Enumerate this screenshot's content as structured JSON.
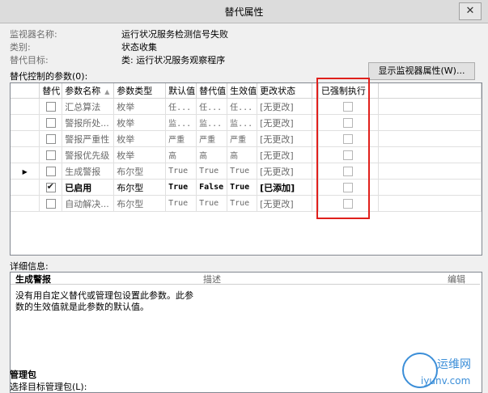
{
  "window": {
    "title": "替代属性",
    "close_symbol": "✕"
  },
  "info": [
    {
      "key": "监视器名称:",
      "value": "运行状况服务检测信号失败"
    },
    {
      "key": "类别:",
      "value": "状态收集"
    },
    {
      "key": "替代目标:",
      "value": "类: 运行状况服务观察程序"
    }
  ],
  "show_monitor_button": "显示监视器属性(W)...",
  "params_label": "替代控制的参数(0):",
  "grid": {
    "columns": [
      "替代",
      "参数名称",
      "参数类型",
      "默认值",
      "替代值",
      "生效值",
      "更改状态",
      "已强制执行"
    ],
    "rows": [
      {
        "override": false,
        "name": "汇总算法",
        "type": "枚举",
        "default": "任...",
        "override_value": "任...",
        "effective": "任...",
        "status": "[无更改]",
        "enforced": false,
        "active": false,
        "current": false
      },
      {
        "override": false,
        "name": "警报所处...",
        "type": "枚举",
        "default": "监...",
        "override_value": "监...",
        "effective": "监...",
        "status": "[无更改]",
        "enforced": false,
        "active": false,
        "current": false
      },
      {
        "override": false,
        "name": "警报严重性",
        "type": "枚举",
        "default": "严重",
        "override_value": "严重",
        "effective": "严重",
        "status": "[无更改]",
        "enforced": false,
        "active": false,
        "current": false
      },
      {
        "override": false,
        "name": "警报优先级",
        "type": "枚举",
        "default": "高",
        "override_value": "高",
        "effective": "高",
        "status": "[无更改]",
        "enforced": false,
        "active": false,
        "current": false
      },
      {
        "override": false,
        "name": "生成警报",
        "type": "布尔型",
        "default": "True",
        "override_value": "True",
        "effective": "True",
        "status": "[无更改]",
        "enforced": false,
        "active": false,
        "current": true
      },
      {
        "override": true,
        "name": "已启用",
        "type": "布尔型",
        "default": "True",
        "override_value": "False",
        "effective": "True",
        "status": "[已添加]",
        "enforced": false,
        "active": true,
        "current": false
      },
      {
        "override": false,
        "name": "自动解决...",
        "type": "布尔型",
        "default": "True",
        "override_value": "True",
        "effective": "True",
        "status": "[无更改]",
        "enforced": false,
        "active": false,
        "current": false
      }
    ]
  },
  "detail_label": "详细信息:",
  "detail": {
    "title": "生成警报",
    "col_desc": "描述",
    "col_edit": "编辑",
    "description": "没有用自定义替代或管理包设置此参数。此参数的生效值就是此参数的默认值。"
  },
  "mp": {
    "title": "管理包",
    "select_label": "选择目标管理包(L):"
  },
  "watermark": {
    "brand": "运维网",
    "site": "iyunv.com"
  },
  "colors": {
    "highlight": "#e0201c",
    "watermark": "#3b8ed8"
  }
}
